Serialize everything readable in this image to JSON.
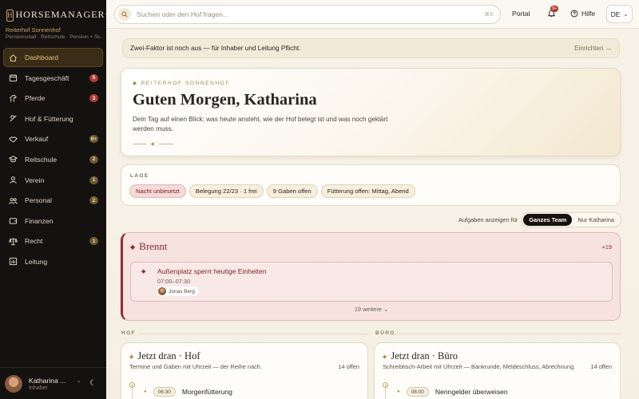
{
  "brand": {
    "name": "HORSEMANAGER",
    "logo_letter": "H",
    "plus": "+",
    "farm_name": "Reiterhof Sonnenhof",
    "farm_sub": "Pensionsstall · Reitschule · Pension + Sc..."
  },
  "sidebar": {
    "items": [
      {
        "label": "Dashboard",
        "icon": "home-icon",
        "badge": ""
      },
      {
        "label": "Tagesgeschäft",
        "icon": "calendar-icon",
        "badge": "5",
        "badge_tone": "red"
      },
      {
        "label": "Pferde",
        "icon": "horse-icon",
        "badge": "3",
        "badge_tone": "red"
      },
      {
        "label": "Hof & Fütterung",
        "icon": "feed-icon",
        "badge": ""
      },
      {
        "label": "Verkauf",
        "icon": "handshake-icon",
        "badge": "9+",
        "badge_tone": "gold"
      },
      {
        "label": "Reitschule",
        "icon": "graduation-cap-icon",
        "badge": "2",
        "badge_tone": "gold"
      },
      {
        "label": "Verein",
        "icon": "users-icon",
        "badge": "1",
        "badge_tone": "gold"
      },
      {
        "label": "Personal",
        "icon": "team-icon",
        "badge": "2",
        "badge_tone": "gold"
      },
      {
        "label": "Finanzen",
        "icon": "wallet-icon",
        "badge": ""
      },
      {
        "label": "Recht",
        "icon": "scale-icon",
        "badge": "1",
        "badge_tone": "gold"
      },
      {
        "label": "Leitung",
        "icon": "chart-icon",
        "badge": ""
      }
    ]
  },
  "user": {
    "name": "Katharina ...",
    "role": "Inhaber"
  },
  "topbar": {
    "search_placeholder": "Suchen oder den Hof fragen...",
    "search_shortcut": "⌘K",
    "portal_label": "Portal",
    "bell_badge": "9+",
    "help_label": "Hilfe",
    "lang": "DE"
  },
  "warning": {
    "text": "Zwei-Faktor ist noch aus — für Inhaber und Leitung Pflicht.",
    "action": "Einrichten →"
  },
  "hero": {
    "eyebrow": "REITERHOF SONNENHOF",
    "title": "Guten Morgen, Katharina",
    "text": "Dein Tag auf einen Blick: was heute ansteht, wie der Hof belegt ist und was noch geklärt werden muss."
  },
  "lage": {
    "label": "LAGE",
    "chips": [
      "Nacht unbesetzt",
      "Belegung 22/23 · 1 frei",
      "9 Gaben offen",
      "Fütterung offen: Mittag, Abend"
    ]
  },
  "filter": {
    "label": "Aufgaben anzeigen für",
    "options": [
      "Ganzes Team",
      "Nur Katharina"
    ]
  },
  "brennt": {
    "title": "Brennt",
    "count": "+19",
    "task": {
      "title": "Außenplatz sperrt heutige Einheiten",
      "time": "07:00–07:30",
      "assignee": "Jonas Berg"
    },
    "more": "19 weitere"
  },
  "sections": {
    "hof": "HOF",
    "buero": "BÜRO"
  },
  "cards": {
    "hof": {
      "title": "Jetzt dran · Hof",
      "sub": "Termine und Gaben mit Uhrzeit — der Reihe nach.",
      "count": "14 offen",
      "entry_time": "06:30",
      "entry_title": "Morgenfütterung"
    },
    "buero": {
      "title": "Jetzt dran · Büro",
      "sub": "Schreibtisch-Arbeit mit Uhrzeit — Bankrunde, Meldeschluss, Abrechnung.",
      "count": "14 offen",
      "entry_time": "08:00",
      "entry_title": "Nenngelder überweisen"
    }
  },
  "colors": {
    "sidebar_bg": "#141210",
    "accent_gold": "#c9a45c",
    "danger": "#9c2a2a",
    "page_bg": "#f6f1e7"
  }
}
